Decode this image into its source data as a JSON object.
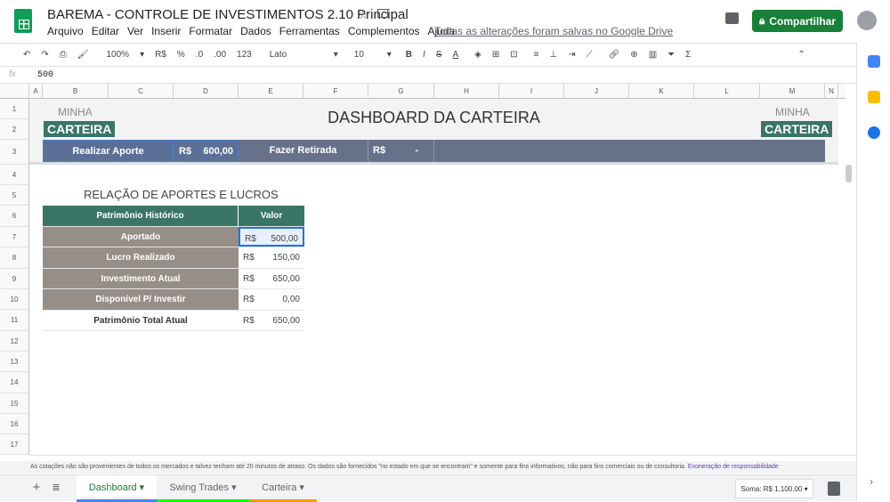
{
  "header": {
    "title": "BAREMA - CONTROLE DE INVESTIMENTOS 2.10 Principal",
    "menu": [
      "Arquivo",
      "Editar",
      "Ver",
      "Inserir",
      "Formatar",
      "Dados",
      "Ferramentas",
      "Complementos",
      "Ajuda"
    ],
    "saved": "Todas as alterações foram salvas no Google Drive",
    "share": "Compartilhar"
  },
  "toolbar": {
    "zoom": "100%",
    "currency": "R$",
    "percent": "%",
    "dec_less": ".0",
    "dec_more": ".00",
    "format": "123",
    "font": "Lato",
    "size": "10"
  },
  "formula": {
    "fx": "fx",
    "value": "500"
  },
  "columns": [
    "A",
    "B",
    "C",
    "D",
    "E",
    "F",
    "G",
    "H",
    "I",
    "J",
    "K",
    "L",
    "M",
    "N"
  ],
  "rows": [
    "1",
    "2",
    "3",
    "4",
    "5",
    "6",
    "7",
    "8",
    "9",
    "10",
    "11",
    "12",
    "13",
    "14",
    "15",
    "16",
    "17"
  ],
  "sheet": {
    "minha": "MINHA",
    "carteira": "CARTEIRA",
    "title": "DASHBOARD DA CARTEIRA",
    "aporte_label": "Realizar Aporte",
    "aporte_cur": "R$",
    "aporte_val": "600,00",
    "retirada_label": "Fazer Retirada",
    "retirada_cur": "R$",
    "retirada_val": "-",
    "section": "RELAÇÃO DE APORTES E LUCROS",
    "col1": "Patrimônio Histórico",
    "col2": "Valor",
    "table": [
      {
        "label": "Aportado",
        "cur": "R$",
        "val": "500,00"
      },
      {
        "label": "Lucro Realizado",
        "cur": "R$",
        "val": "150,00"
      },
      {
        "label": "Investimento Atual",
        "cur": "R$",
        "val": "650,00"
      },
      {
        "label": "Disponível P/ Investir",
        "cur": "R$",
        "val": "0,00"
      },
      {
        "label": "Patrimônio Total Atual",
        "cur": "R$",
        "val": "650,00"
      }
    ]
  },
  "disclaimer": "As cotações não são provenientes de todos os mercados e talvez tenham até 20 minutos de atraso. Os dados são fornecidos \"no estado em que se encontram\" e somente para fins informativos, não para fins comerciais ou de consultoria.",
  "disclaimer_link": "Exoneração de responsabilidade",
  "tabs": [
    {
      "label": "Dashboard",
      "color": "#4285f4"
    },
    {
      "label": "Swing Trades",
      "color": "#00ff00"
    },
    {
      "label": "Carteira",
      "color": "#ff9900"
    }
  ],
  "sum": "Soma: R$ 1.100,00"
}
